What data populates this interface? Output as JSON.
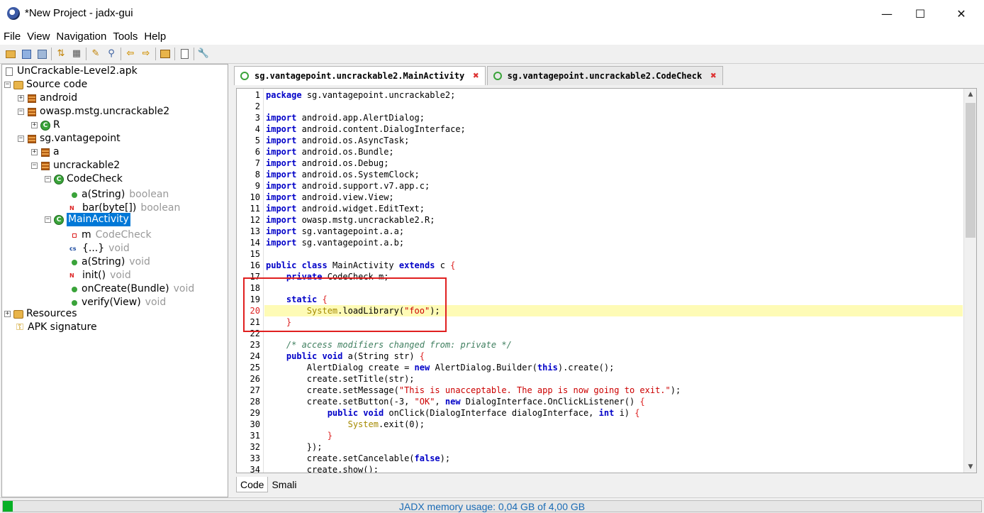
{
  "window": {
    "title": "*New Project - jadx-gui",
    "minimize_glyph": "—",
    "maximize_glyph": "☐",
    "close_glyph": "✕"
  },
  "menu": [
    "File",
    "View",
    "Navigation",
    "Tools",
    "Help"
  ],
  "toolbar": {
    "icons": [
      "open-file-icon",
      "add-files-icon",
      "save-all-icon",
      "sync-icon",
      "flatten-icon",
      "search-icon",
      "find-icon",
      "back-icon",
      "forward-icon",
      "decompile-icon",
      "log-icon",
      "preferences-icon"
    ]
  },
  "tree": {
    "root": "UnCrackable-Level2.apk",
    "source_code": "Source code",
    "pkg_android": "android",
    "pkg_owasp": "owasp.mstg.uncrackable2",
    "cls_r": "R",
    "pkg_sg": "sg.vantagepoint",
    "pkg_a": "a",
    "pkg_uncrackable2": "uncrackable2",
    "cls_codecheck": "CodeCheck",
    "m_a_string": "a(String)",
    "m_a_string_type": "boolean",
    "m_bar": "bar(byte[])",
    "m_bar_type": "boolean",
    "cls_mainactivity": "MainActivity",
    "f_m": "m",
    "f_m_type": "CodeCheck",
    "static_init": "{...}",
    "static_init_type": "void",
    "ma_a_string": "a(String)",
    "ma_a_string_type": "void",
    "ma_init": "init()",
    "ma_init_type": "void",
    "ma_oncreate": "onCreate(Bundle)",
    "ma_oncreate_type": "void",
    "ma_verify": "verify(View)",
    "ma_verify_type": "void",
    "resources": "Resources",
    "apk_signature": "APK signature",
    "static_badge": "cs",
    "native_badge": "N"
  },
  "tabs": [
    {
      "label": "sg.vantagepoint.uncrackable2.MainActivity",
      "active": true
    },
    {
      "label": "sg.vantagepoint.uncrackable2.CodeCheck",
      "active": false
    }
  ],
  "tab_close_glyph": "✖",
  "bottom_tabs": [
    "Code",
    "Smali"
  ],
  "status": {
    "memory_text": "JADX memory usage: 0,04 GB of 4,00 GB",
    "memory_fraction": 0.01
  },
  "code": {
    "line_numbers": [
      "1",
      "2",
      "3",
      "4",
      "5",
      "6",
      "7",
      "8",
      "9",
      "10",
      "11",
      "12",
      "13",
      "14",
      "15",
      "16",
      "17",
      "18",
      "19",
      "20",
      "21",
      "22",
      "23",
      "24",
      "25",
      "26",
      "27",
      "28",
      "29",
      "30",
      "31",
      "32",
      "33",
      "34"
    ],
    "highlighted_line": "20",
    "lines": [
      [
        [
          "kw",
          "package"
        ],
        [
          "",
          "sg.vantagepoint.uncrackable2;"
        ]
      ],
      [],
      [
        [
          "kw",
          "import"
        ],
        [
          "",
          "android.app.AlertDialog;"
        ]
      ],
      [
        [
          "kw",
          "import"
        ],
        [
          "",
          "android.content.DialogInterface;"
        ]
      ],
      [
        [
          "kw",
          "import"
        ],
        [
          "",
          "android.os.AsyncTask;"
        ]
      ],
      [
        [
          "kw",
          "import"
        ],
        [
          "",
          "android.os.Bundle;"
        ]
      ],
      [
        [
          "kw",
          "import"
        ],
        [
          "",
          "android.os.Debug;"
        ]
      ],
      [
        [
          "kw",
          "import"
        ],
        [
          "",
          "android.os.SystemClock;"
        ]
      ],
      [
        [
          "kw",
          "import"
        ],
        [
          "",
          "android.support.v7.app.c;"
        ]
      ],
      [
        [
          "kw",
          "import"
        ],
        [
          "",
          "android.view.View;"
        ]
      ],
      [
        [
          "kw",
          "import"
        ],
        [
          "",
          "android.widget.EditText;"
        ]
      ],
      [
        [
          "kw",
          "import"
        ],
        [
          "",
          "owasp.mstg.uncrackable2.R;"
        ]
      ],
      [
        [
          "kw",
          "import"
        ],
        [
          "",
          "sg.vantagepoint.a.a;"
        ]
      ],
      [
        [
          "kw",
          "import"
        ],
        [
          "",
          "sg.vantagepoint.a.b;"
        ]
      ],
      [],
      [
        [
          "kw",
          "public class"
        ],
        [
          "",
          "MainActivity"
        ],
        [
          "kw",
          "extends"
        ],
        [
          "",
          "c"
        ],
        [
          "br",
          "{"
        ]
      ],
      [
        [
          "",
          "    "
        ],
        [
          "kw",
          "private"
        ],
        [
          "",
          "CodeCheck m;"
        ]
      ],
      [],
      [
        [
          "",
          "    "
        ],
        [
          "kw",
          "static"
        ],
        [
          "br",
          "{"
        ]
      ],
      [
        [
          "",
          "        "
        ],
        [
          "gold",
          "System"
        ],
        [
          "",
          ".loadLibrary("
        ],
        [
          "str",
          "\"foo\""
        ],
        [
          "",
          ");"
        ]
      ],
      [
        [
          "",
          "    "
        ],
        [
          "br",
          "}"
        ]
      ],
      [],
      [
        [
          "",
          "    "
        ],
        [
          "cmt",
          "/* access modifiers changed from: private */"
        ]
      ],
      [
        [
          "",
          "    "
        ],
        [
          "kw",
          "public void"
        ],
        [
          "",
          "a(String str)"
        ],
        [
          "br",
          "{"
        ]
      ],
      [
        [
          "",
          "        AlertDialog create = "
        ],
        [
          "kw",
          "new"
        ],
        [
          "",
          "AlertDialog.Builder("
        ],
        [
          "kw",
          "this"
        ],
        [
          "",
          ").create();"
        ]
      ],
      [
        [
          "",
          "        create.setTitle(str);"
        ]
      ],
      [
        [
          "",
          "        create.setMessage("
        ],
        [
          "str",
          "\"This is unacceptable. The app is now going to exit.\""
        ],
        [
          "",
          ");"
        ]
      ],
      [
        [
          "",
          "        create.setButton(-3, "
        ],
        [
          "str",
          "\"OK\""
        ],
        [
          "",
          ", "
        ],
        [
          "kw",
          "new"
        ],
        [
          "",
          "DialogInterface.OnClickListener()"
        ],
        [
          "br",
          "{"
        ]
      ],
      [
        [
          "",
          "            "
        ],
        [
          "kw",
          "public void"
        ],
        [
          "",
          "onClick(DialogInterface dialogInterface, "
        ],
        [
          "kw",
          "int"
        ],
        [
          "",
          "i)"
        ],
        [
          "br",
          "{"
        ]
      ],
      [
        [
          "",
          "                "
        ],
        [
          "gold",
          "System"
        ],
        [
          "",
          ".exit(0);"
        ]
      ],
      [
        [
          "",
          "            "
        ],
        [
          "br",
          "}"
        ]
      ],
      [
        [
          "",
          "        });"
        ]
      ],
      [
        [
          "",
          "        create.setCancelable("
        ],
        [
          "kw",
          "false"
        ],
        [
          "",
          ");"
        ]
      ],
      [
        [
          "",
          "        create.show();"
        ]
      ]
    ]
  }
}
